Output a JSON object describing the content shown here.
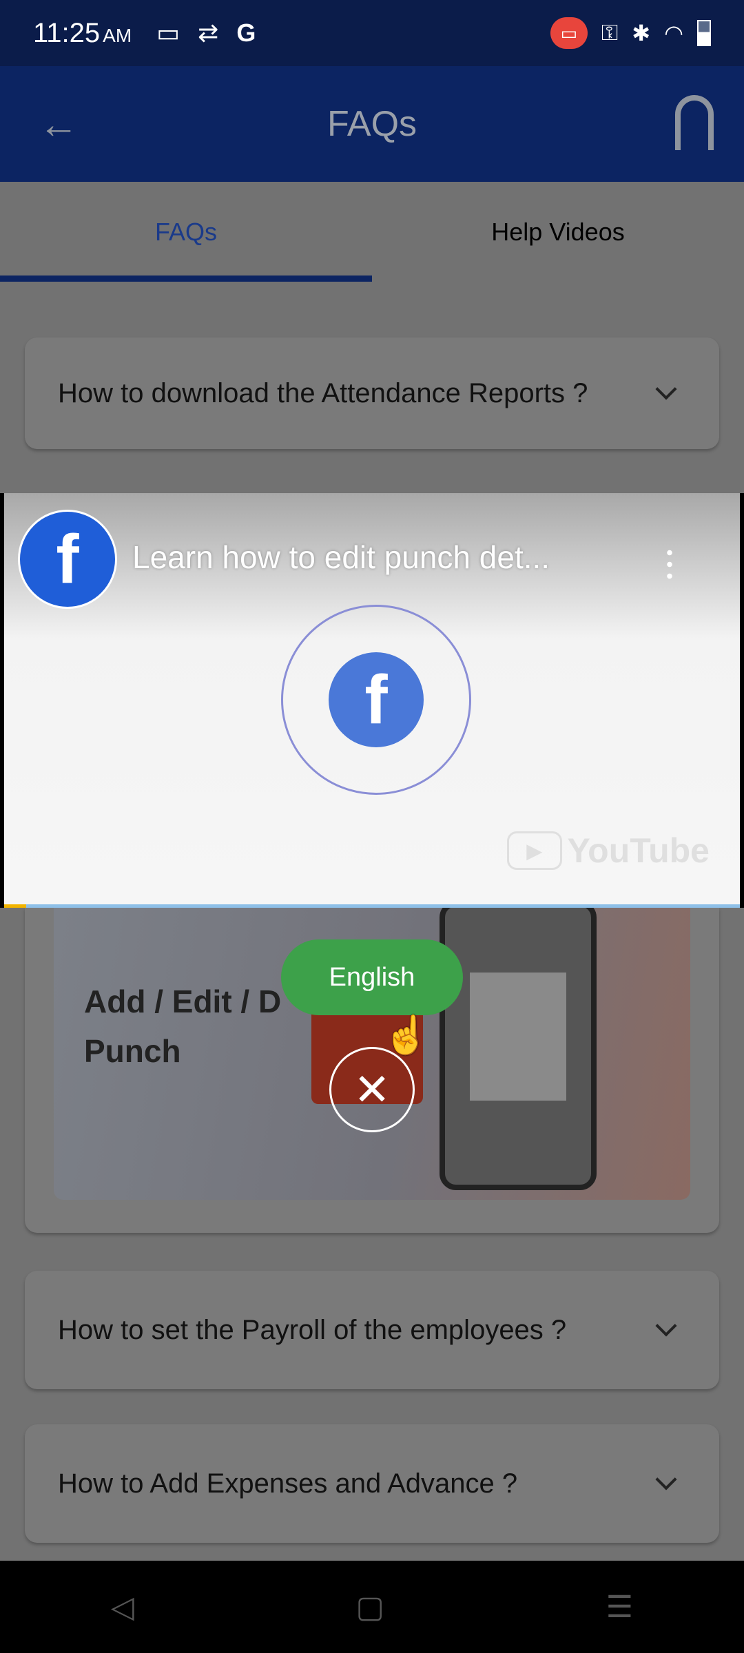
{
  "status_bar": {
    "time": "11:25",
    "ampm": "AM",
    "left_icons": [
      "screen-record-icon",
      "sync-icon",
      "google-icon"
    ],
    "right_icons": [
      "recording-icon",
      "vpn-key-icon",
      "bluetooth-icon",
      "wifi-icon",
      "battery-icon"
    ]
  },
  "app_bar": {
    "title": "FAQs",
    "back_icon": "arrow-left-icon",
    "support_icon": "headset-icon"
  },
  "tabs": [
    {
      "label": "FAQs",
      "active": true
    },
    {
      "label": "Help Videos",
      "active": false
    }
  ],
  "faqs": [
    {
      "question": "How to download the Attendance Reports ?"
    },
    {
      "question": "How to set the Payroll of the employees ?"
    },
    {
      "question": "How to Add Expenses and Advance ?"
    }
  ],
  "video_player": {
    "title": "Learn how to edit punch det...",
    "channel_logo": "f",
    "branding": "YouTube",
    "progress_percent": 3
  },
  "video_tile": {
    "title_line1": "Add / Edit / D",
    "title_line2": "Punch"
  },
  "overlay": {
    "language_button": "English",
    "close_icon": "close-icon"
  },
  "nav_bar": {
    "back": "◁",
    "home": "▢",
    "menu": "☰"
  },
  "colors": {
    "app_bar": "#0c2462",
    "status_bar": "#0b1c4a",
    "language_button": "#3da14a",
    "tab_indicator": "#0c2462"
  }
}
